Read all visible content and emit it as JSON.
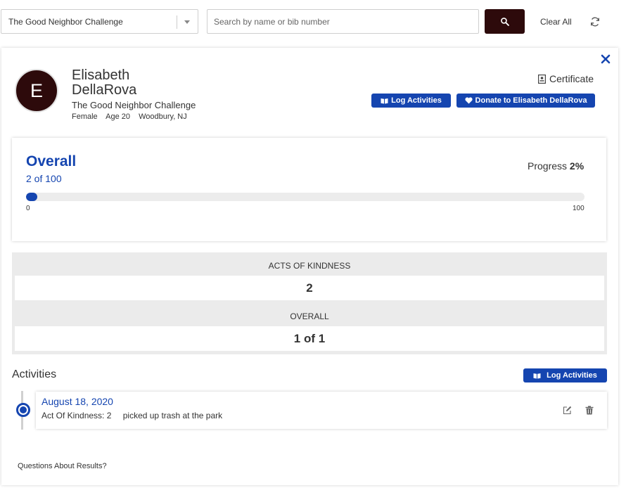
{
  "toolbar": {
    "event_select_value": "The Good Neighbor Challenge",
    "search_placeholder": "Search by name or bib number",
    "clear_all_label": "Clear All",
    "search_icon": "search-icon",
    "refresh_icon": "refresh-icon"
  },
  "profile": {
    "avatar_initial": "E",
    "name": "Elisabeth DellaRova",
    "event": "The Good Neighbor Challenge",
    "gender": "Female",
    "age": "Age 20",
    "location": "Woodbury, NJ"
  },
  "actions": {
    "certificate_label": "Certificate",
    "log_activities_label": "Log Activities",
    "donate_label": "Donate to Elisabeth DellaRova"
  },
  "overall": {
    "title": "Overall",
    "count_text": "2 of 100",
    "progress_label": "Progress",
    "progress_value": "2%",
    "progress_fraction": 0.02,
    "min_label": "0",
    "max_label": "100"
  },
  "stats": [
    {
      "label": "ACTS OF KINDNESS",
      "value": "2"
    },
    {
      "label": "OVERALL",
      "value": "1 of 1"
    }
  ],
  "activities": {
    "title": "Activities",
    "log_button_label": "Log Activities",
    "items": [
      {
        "date": "August 18, 2020",
        "metric": "Act Of Kindness: 2",
        "note": "picked up trash at the park"
      }
    ]
  },
  "footer": {
    "questions_label": "Questions About Results?"
  },
  "colors": {
    "accent_blue": "#1545b0",
    "dark_brand": "#2d0a0b"
  }
}
